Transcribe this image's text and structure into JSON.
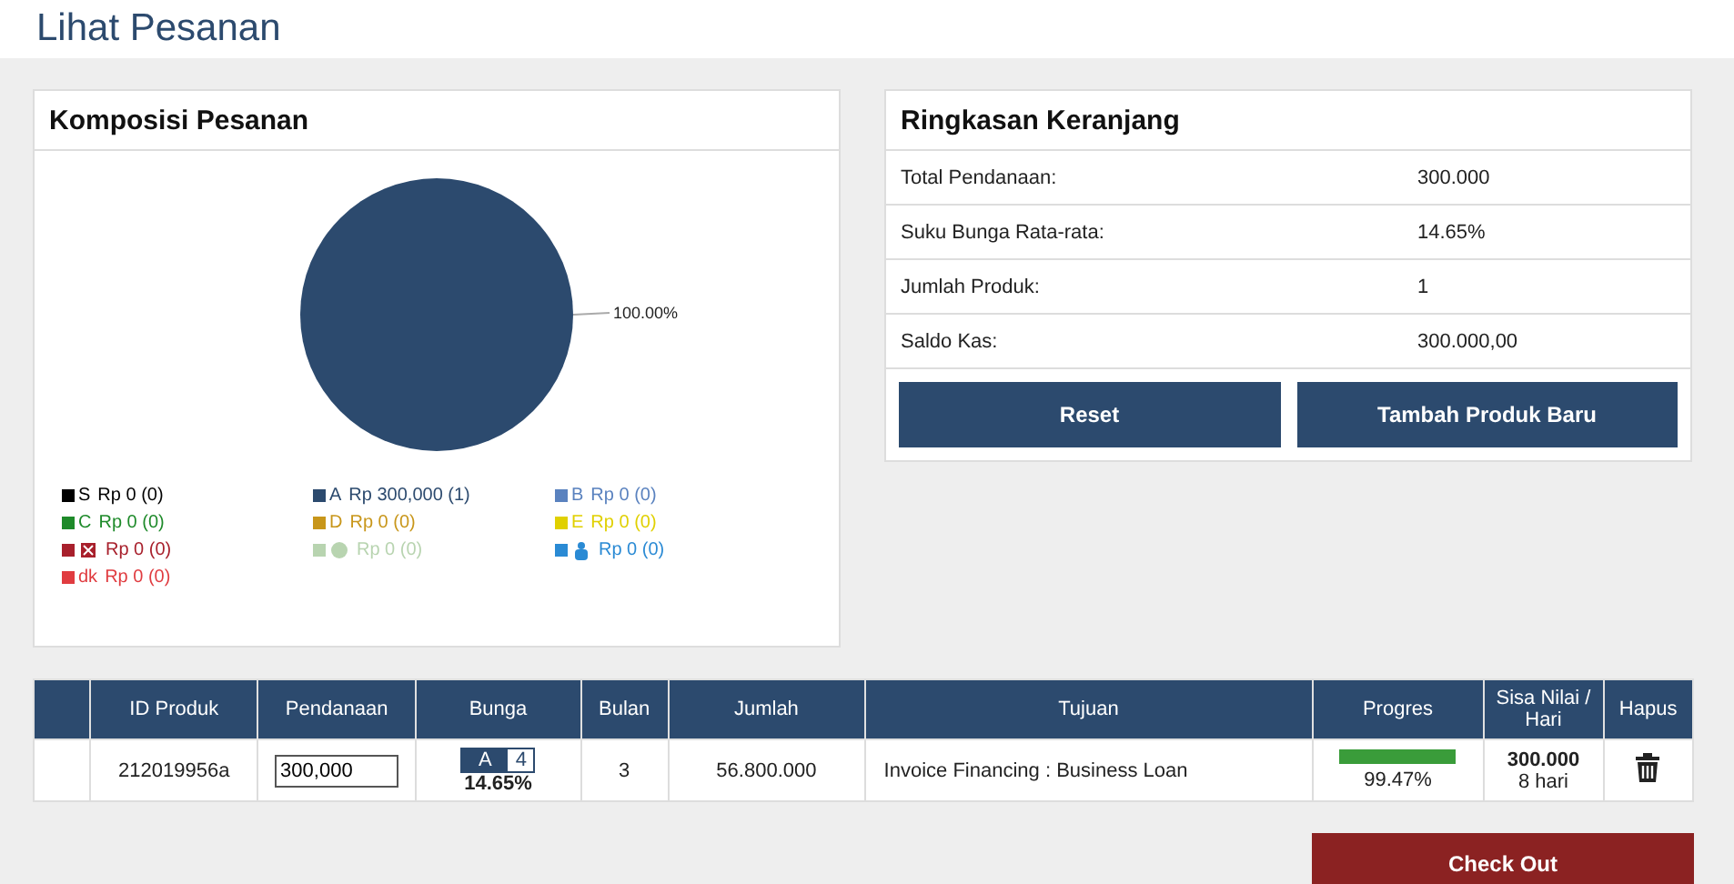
{
  "page_title": "Lihat Pesanan",
  "composition": {
    "title": "Komposisi Pesanan",
    "chart_data": {
      "type": "pie",
      "values": [
        100
      ],
      "value_labels": [
        "100.00%"
      ]
    },
    "legend": [
      {
        "kind": "text",
        "label": "S",
        "amount": "Rp 0 (0)",
        "color": "#000000"
      },
      {
        "kind": "text",
        "label": "A",
        "amount": "Rp 300,000 (1)",
        "color": "#2c4a6e"
      },
      {
        "kind": "text",
        "label": "B",
        "amount": "Rp 0 (0)",
        "color": "#5a82bf"
      },
      {
        "kind": "text",
        "label": "C",
        "amount": "Rp 0 (0)",
        "color": "#1e8a2a"
      },
      {
        "kind": "text",
        "label": "D",
        "amount": "Rp 0 (0)",
        "color": "#c8961a"
      },
      {
        "kind": "text",
        "label": "E",
        "amount": "Rp 0 (0)",
        "color": "#e0d000"
      },
      {
        "kind": "icon",
        "amount": "Rp 0 (0)",
        "color": "#a8202c"
      },
      {
        "kind": "icon",
        "amount": "Rp 0 (0)",
        "color": "#b8d4b0"
      },
      {
        "kind": "icon",
        "amount": "Rp 0 (0)",
        "color": "#2a8ad4"
      },
      {
        "kind": "text",
        "label": "dk",
        "amount": "Rp 0 (0)",
        "color": "#e03c40"
      }
    ]
  },
  "summary": {
    "title": "Ringkasan Keranjang",
    "rows": [
      {
        "label": "Total Pendanaan:",
        "value": "300.000"
      },
      {
        "label": "Suku Bunga Rata-rata:",
        "value": "14.65%"
      },
      {
        "label": "Jumlah Produk:",
        "value": "1"
      },
      {
        "label": "Saldo Kas:",
        "value": "300.000,00"
      }
    ],
    "buttons": [
      "Reset",
      "Tambah Produk Baru"
    ]
  },
  "table": {
    "columns": [
      "ID Produk",
      "Pendanaan",
      "Bunga",
      "Bulan",
      "Jumlah",
      "Tujuan",
      "Progres",
      "Sisa Nilai / Hari",
      "Hapus"
    ],
    "rows": [
      {
        "id": "212019956a",
        "funding": "300,000",
        "grade": "A",
        "grade_level": "4",
        "rate": "14.65%",
        "months": "3",
        "amount": "56.800.000",
        "purpose": "Invoice Financing : Business Loan",
        "level": 0.9947,
        "progress": "99.47%",
        "remaining": "300.000",
        "days": "8 hari"
      }
    ]
  },
  "checkout": "Check Out"
}
